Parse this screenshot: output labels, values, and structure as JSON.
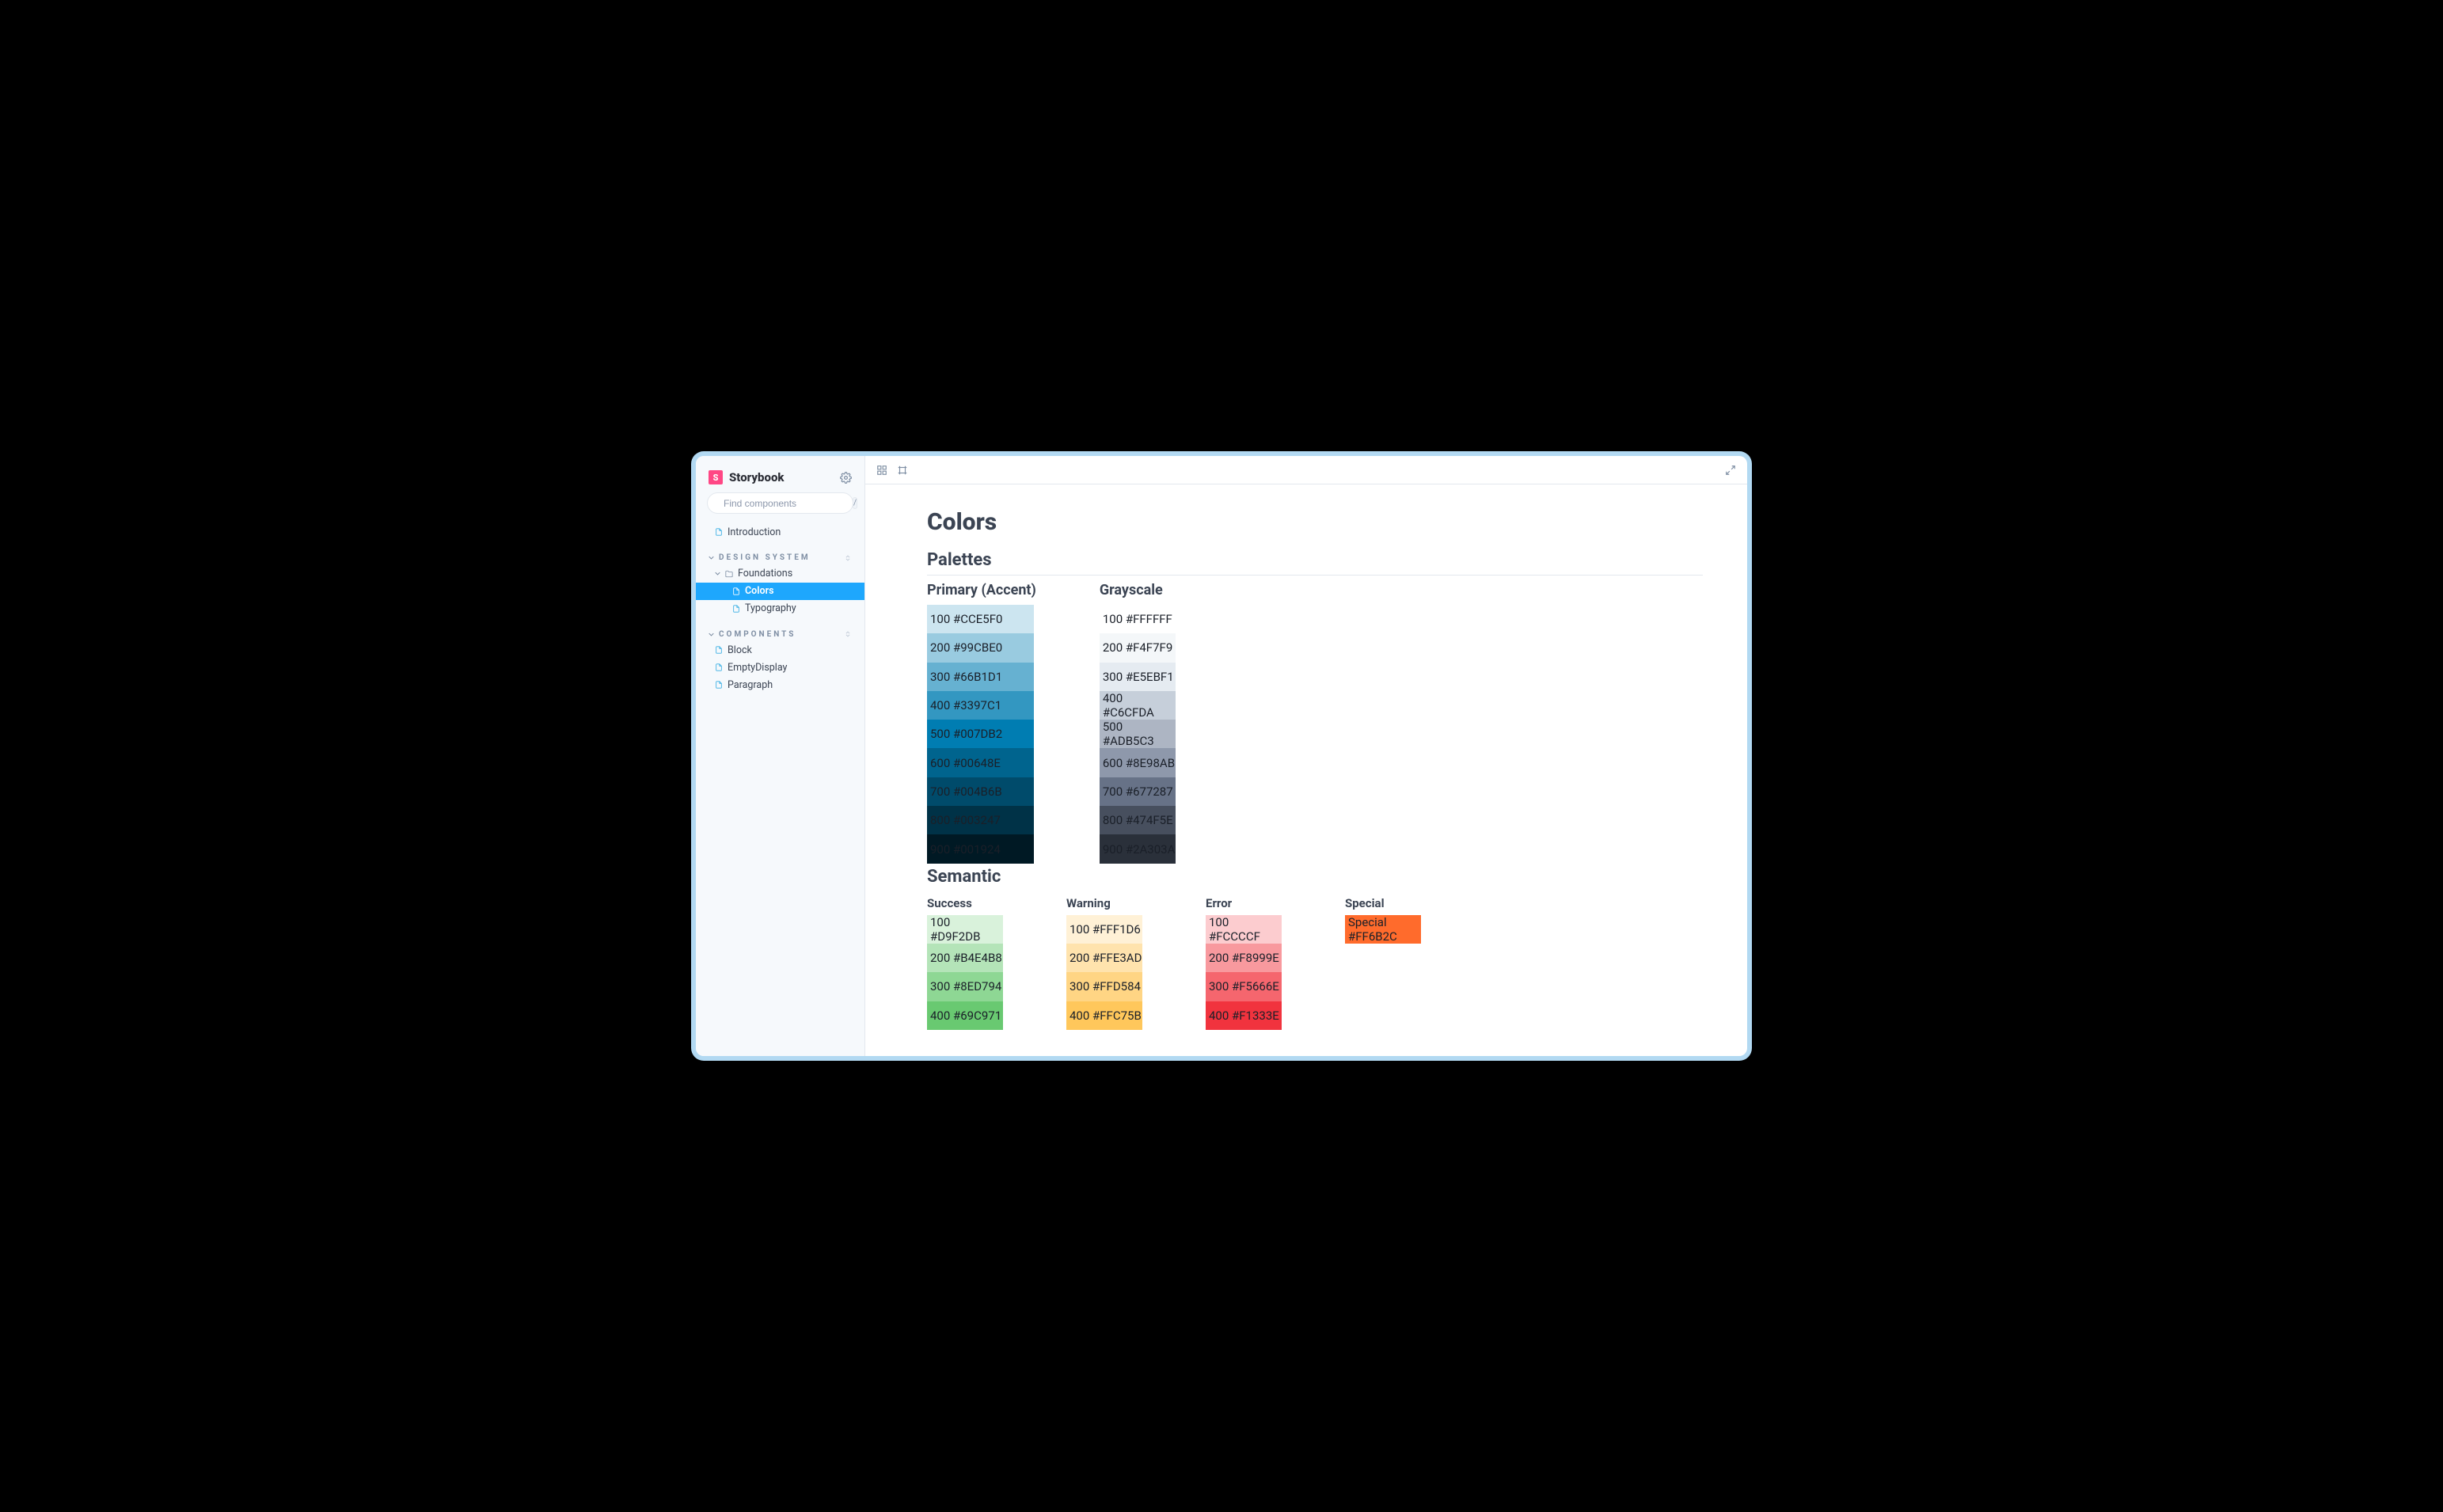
{
  "brand": {
    "name": "Storybook"
  },
  "search": {
    "placeholder": "Find components",
    "shortcut": "/"
  },
  "nav": {
    "introduction": "Introduction",
    "groups": [
      {
        "title": "Design System",
        "items": [
          {
            "label": "Foundations",
            "kind": "folder",
            "children": [
              {
                "label": "Colors",
                "active": true
              },
              {
                "label": "Typography"
              }
            ]
          }
        ]
      },
      {
        "title": "Components",
        "items": [
          {
            "label": "Block"
          },
          {
            "label": "EmptyDisplay"
          },
          {
            "label": "Paragraph"
          }
        ]
      }
    ]
  },
  "page": {
    "title": "Colors",
    "palettes_heading": "Palettes",
    "semantic_heading": "Semantic"
  },
  "palettes": {
    "primary": {
      "title": "Primary (Accent)",
      "swatches": [
        {
          "label": "100 #CCE5F0",
          "hex": "#CCE5F0"
        },
        {
          "label": "200 #99CBE0",
          "hex": "#99CBE0"
        },
        {
          "label": "300 #66B1D1",
          "hex": "#66B1D1"
        },
        {
          "label": "400 #3397C1",
          "hex": "#3397C1"
        },
        {
          "label": "500 #007DB2",
          "hex": "#007DB2"
        },
        {
          "label": "600 #00648E",
          "hex": "#00648E"
        },
        {
          "label": "700 #004B6B",
          "hex": "#004B6B"
        },
        {
          "label": "800 #003247",
          "hex": "#003247"
        },
        {
          "label": "900 #001924",
          "hex": "#001924"
        }
      ]
    },
    "grayscale": {
      "title": "Grayscale",
      "swatches": [
        {
          "label": "100 #FFFFFF",
          "hex": "#FFFFFF"
        },
        {
          "label": "200 #F4F7F9",
          "hex": "#F4F7F9"
        },
        {
          "label": "300 #E5EBF1",
          "hex": "#E5EBF1"
        },
        {
          "label": "400 #C6CFDA",
          "hex": "#C6CFDA"
        },
        {
          "label": "500 #ADB5C3",
          "hex": "#ADB5C3"
        },
        {
          "label": "600 #8E98AB",
          "hex": "#8E98AB"
        },
        {
          "label": "700 #677287",
          "hex": "#677287"
        },
        {
          "label": "800 #474F5E",
          "hex": "#474F5E"
        },
        {
          "label": "900 #2A303A",
          "hex": "#2A303A"
        }
      ]
    }
  },
  "semantic": {
    "success": {
      "title": "Success",
      "swatches": [
        {
          "label": "100 #D9F2DB",
          "hex": "#D9F2DB"
        },
        {
          "label": "200 #B4E4B8",
          "hex": "#B4E4B8"
        },
        {
          "label": "300 #8ED794",
          "hex": "#8ED794"
        },
        {
          "label": "400 #69C971",
          "hex": "#69C971"
        }
      ]
    },
    "warning": {
      "title": "Warning",
      "swatches": [
        {
          "label": "100 #FFF1D6",
          "hex": "#FFF1D6"
        },
        {
          "label": "200 #FFE3AD",
          "hex": "#FFE3AD"
        },
        {
          "label": "300 #FFD584",
          "hex": "#FFD584"
        },
        {
          "label": "400 #FFC75B",
          "hex": "#FFC75B"
        }
      ]
    },
    "error": {
      "title": "Error",
      "swatches": [
        {
          "label": "100 #FCCCCF",
          "hex": "#FCCCCF"
        },
        {
          "label": "200 #F8999E",
          "hex": "#F8999E"
        },
        {
          "label": "300 #F5666E",
          "hex": "#F5666E"
        },
        {
          "label": "400 #F1333E",
          "hex": "#F1333E"
        }
      ]
    },
    "special": {
      "title": "Special",
      "swatches": [
        {
          "label": "Special #FF6B2C",
          "hex": "#FF6B2C"
        }
      ]
    }
  }
}
